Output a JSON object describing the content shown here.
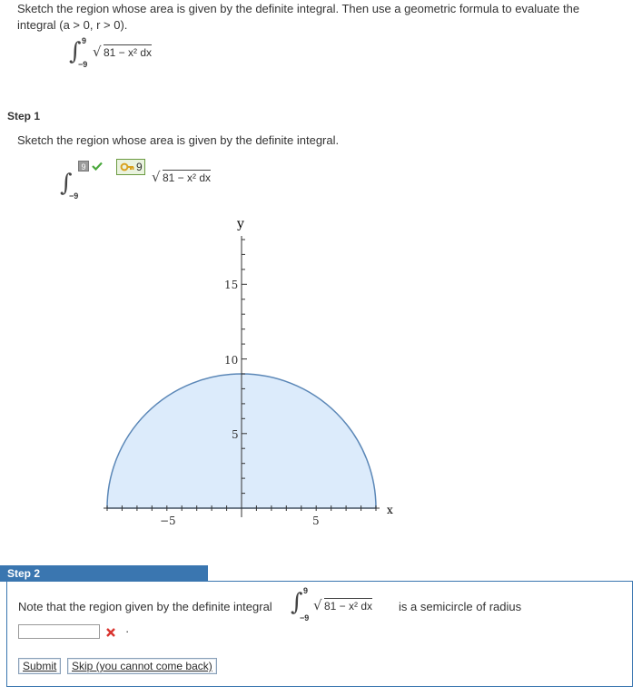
{
  "problem": {
    "line1": "Sketch the region whose area is given by the definite integral. Then use a geometric formula to evaluate the",
    "line2": "integral (a > 0,  r > 0).",
    "integral": {
      "upper": "9",
      "lower": "−9",
      "integrand": "81 − x² dx"
    }
  },
  "step1": {
    "header": "Step 1",
    "instruction": "Sketch the region whose area is given by the definite integral.",
    "integral": {
      "upper_badge": "9",
      "lower": "−9",
      "key_value": "9",
      "integrand": "81 − x² dx"
    }
  },
  "graph": {
    "y_label": "y",
    "x_label": "x",
    "y_ticks": [
      "15",
      "10",
      "5"
    ],
    "x_ticks": [
      "−5",
      "5"
    ],
    "fill_color": "#dcebfb",
    "stroke_color": "#5b87b7"
  },
  "step2": {
    "header": "Step 2",
    "note_prefix": "Note that the region given by the definite integral",
    "note_suffix": "is a semicircle of radius",
    "integral": {
      "upper": "9",
      "lower": "−9",
      "integrand": "81 − x² dx"
    },
    "answer_value": "",
    "period": "·",
    "submit_label": "Submit",
    "skip_label": "Skip (you cannot come back)"
  },
  "colors": {
    "accent": "#3a76b0",
    "error": "#d9332e",
    "check": "#4aa83c"
  }
}
